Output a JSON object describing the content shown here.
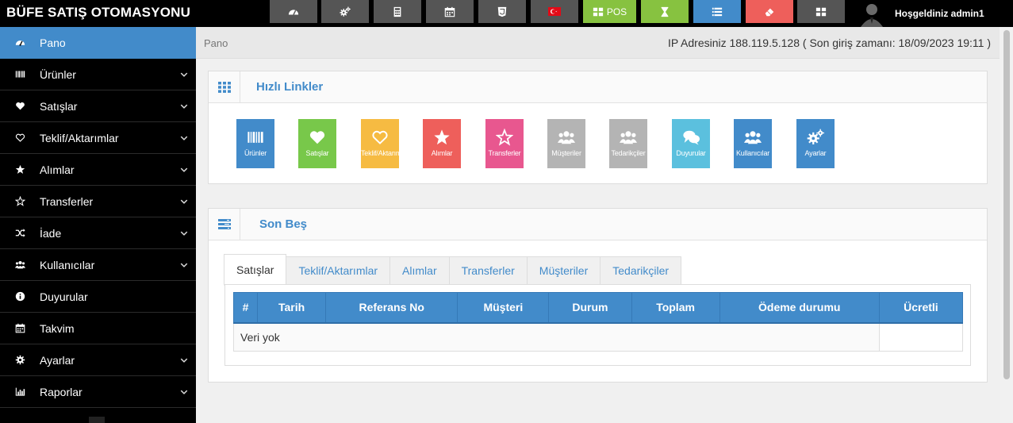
{
  "app": {
    "title": "BÜFE SATIŞ OTOMASYONU"
  },
  "topbar": {
    "buttons": [
      {
        "name": "dashboard",
        "color": "#555555",
        "label": ""
      },
      {
        "name": "cogs",
        "color": "#555555",
        "label": ""
      },
      {
        "name": "calculator",
        "color": "#555555",
        "label": ""
      },
      {
        "name": "calendar",
        "color": "#555555",
        "label": ""
      },
      {
        "name": "css3",
        "color": "#555555",
        "label": ""
      },
      {
        "name": "flag-tr",
        "color": "#555555",
        "label": ""
      },
      {
        "name": "pos",
        "color": "#87c240",
        "label": "POS"
      },
      {
        "name": "hourglass",
        "color": "#87c240",
        "label": ""
      },
      {
        "name": "list",
        "color": "#428bca",
        "label": ""
      },
      {
        "name": "eraser",
        "color": "#ee5f5b",
        "label": ""
      },
      {
        "name": "grid",
        "color": "#555555",
        "label": ""
      }
    ],
    "welcome": "Hoşgeldiniz admin1"
  },
  "sidebar": {
    "items": [
      {
        "label": "Pano",
        "icon": "dashboard-icon",
        "active": true,
        "chevron": false
      },
      {
        "label": "Ürünler",
        "icon": "barcode-icon",
        "chevron": true
      },
      {
        "label": "Satışlar",
        "icon": "heart-icon",
        "chevron": true
      },
      {
        "label": "Teklif/Aktarımlar",
        "icon": "heart-outline-icon",
        "chevron": true
      },
      {
        "label": "Alımlar",
        "icon": "star-icon",
        "chevron": true
      },
      {
        "label": "Transferler",
        "icon": "star-outline-icon",
        "chevron": true
      },
      {
        "label": "İade",
        "icon": "random-icon",
        "chevron": true
      },
      {
        "label": "Kullanıcılar",
        "icon": "users-icon",
        "chevron": true
      },
      {
        "label": "Duyurular",
        "icon": "info-icon",
        "chevron": false
      },
      {
        "label": "Takvim",
        "icon": "calendar-icon",
        "chevron": false
      },
      {
        "label": "Ayarlar",
        "icon": "cog-icon",
        "chevron": true
      },
      {
        "label": "Raporlar",
        "icon": "bar-chart-icon",
        "chevron": true
      }
    ]
  },
  "breadcrumb": {
    "current": "Pano",
    "ip_info": "IP Adresiniz 188.119.5.128 ( Son giriş zamanı: 18/09/2023 19:11 )"
  },
  "quick_links": {
    "title": "Hızlı Linkler",
    "tiles": [
      {
        "label": "Ürünler",
        "icon": "barcode-icon",
        "color": "#428bca"
      },
      {
        "label": "Satışlar",
        "icon": "heart-icon",
        "color": "#78c84a"
      },
      {
        "label": "Teklif/Aktarımlar",
        "icon": "heart-outline-icon",
        "color": "#f6bb42"
      },
      {
        "label": "Alımlar",
        "icon": "star-icon",
        "color": "#ee5f5b"
      },
      {
        "label": "Transferler",
        "icon": "star-outline-icon",
        "color": "#e8578f"
      },
      {
        "label": "Müşteriler",
        "icon": "users-icon",
        "color": "#b4b4b4"
      },
      {
        "label": "Tedarikçiler",
        "icon": "users-icon",
        "color": "#b4b4b4"
      },
      {
        "label": "Duyurular",
        "icon": "comments-icon",
        "color": "#5bc0de"
      },
      {
        "label": "Kullanıcılar",
        "icon": "users-icon",
        "color": "#428bca"
      },
      {
        "label": "Ayarlar",
        "icon": "cogs-icon",
        "color": "#428bca"
      }
    ]
  },
  "recent": {
    "title": "Son Beş",
    "tabs": [
      "Satışlar",
      "Teklif/Aktarımlar",
      "Alımlar",
      "Transferler",
      "Müşteriler",
      "Tedarikçiler"
    ],
    "active_tab": "Satışlar",
    "columns": [
      "#",
      "Tarih",
      "Referans No",
      "Müşteri",
      "Durum",
      "Toplam",
      "Ödeme durumu",
      "Ücretli"
    ],
    "empty_text": "Veri yok"
  }
}
